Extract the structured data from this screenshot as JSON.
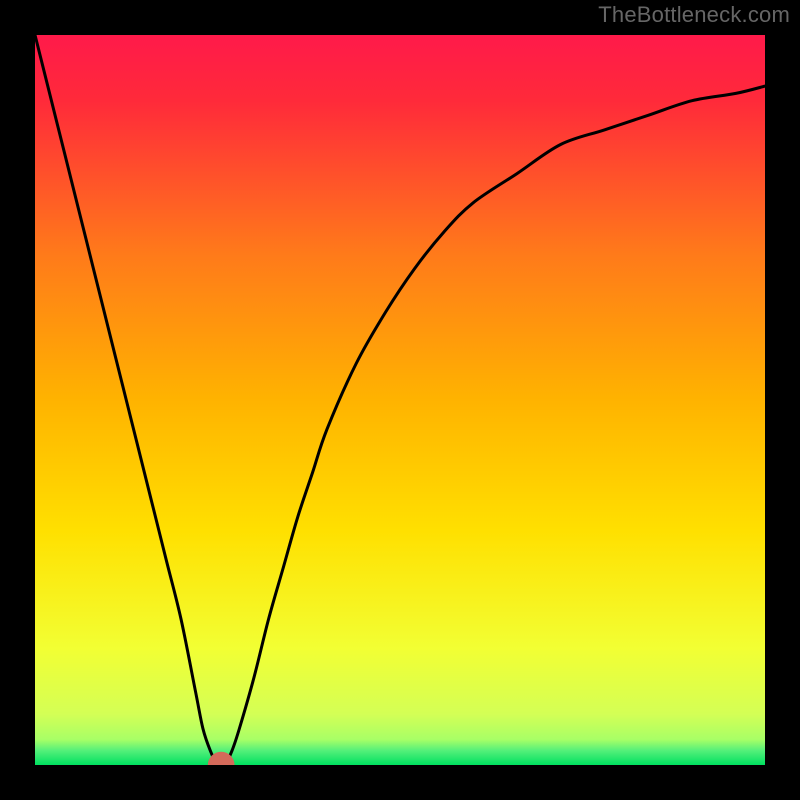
{
  "watermark": "TheBottleneck.com",
  "chart_data": {
    "type": "line",
    "title": "",
    "xlabel": "",
    "ylabel": "",
    "xlim": [
      0,
      100
    ],
    "ylim": [
      0,
      100
    ],
    "grid": false,
    "legend": false,
    "background": {
      "top_color": "#ff1a4a",
      "mid_color": "#ffd400",
      "bottom_color": "#00e060",
      "bottom_band_ratio": 0.03
    },
    "series": [
      {
        "name": "bottleneck-curve",
        "color": "#000000",
        "x": [
          0,
          2,
          4,
          6,
          8,
          10,
          12,
          14,
          16,
          18,
          20,
          22,
          23,
          24,
          25,
          26,
          27,
          28,
          30,
          32,
          34,
          36,
          38,
          40,
          44,
          48,
          52,
          56,
          60,
          66,
          72,
          78,
          84,
          90,
          96,
          100
        ],
        "y": [
          100,
          92,
          84,
          76,
          68,
          60,
          52,
          44,
          36,
          28,
          20,
          10,
          5,
          2,
          0,
          0,
          2,
          5,
          12,
          20,
          27,
          34,
          40,
          46,
          55,
          62,
          68,
          73,
          77,
          81,
          85,
          87,
          89,
          91,
          92,
          93
        ]
      }
    ],
    "marker": {
      "name": "optimal-point",
      "x": 25.5,
      "y": 0,
      "color": "#d46a5a",
      "radius": 1.0
    }
  }
}
